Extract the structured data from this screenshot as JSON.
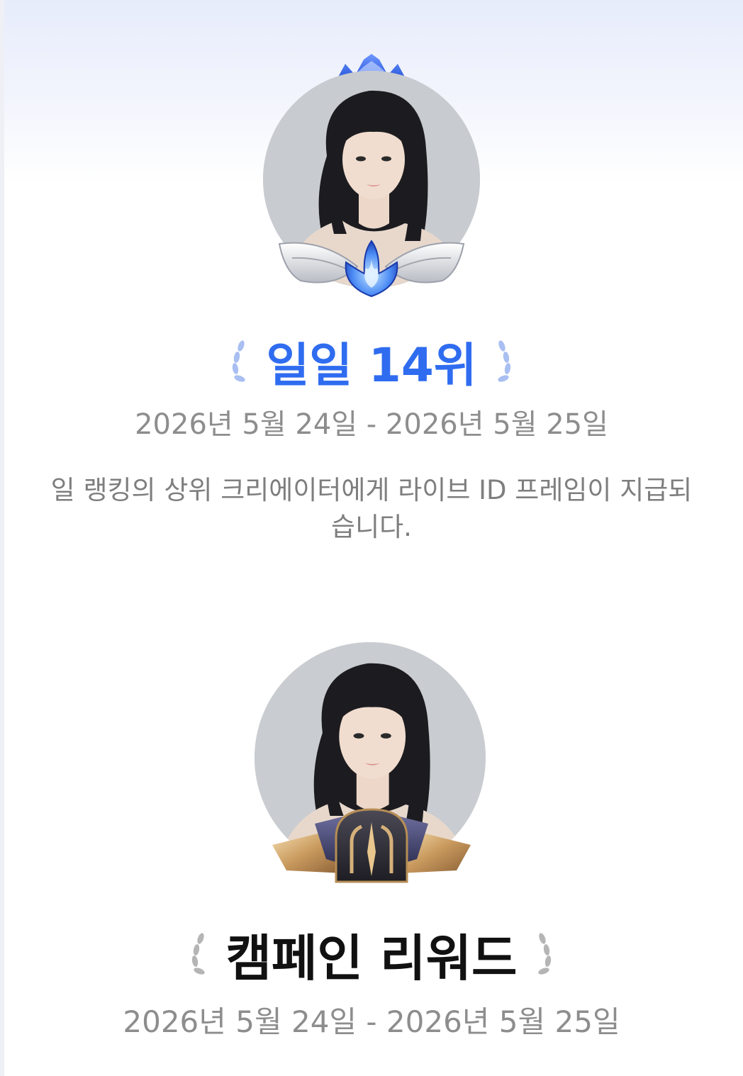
{
  "rewards": [
    {
      "rank_title": "일일 14위",
      "date_range": "2026년 5월 24일 - 2026년 5월 25일",
      "description_line1": "일 랭킹의 상위 크리에이터에게 라이브 ID 프레임이 지급되",
      "description_line2": "습니다.",
      "accent_color": "#2f6cf0",
      "frame_icon": "blue-flame-lotus-icon"
    },
    {
      "rank_title": "캠페인 리워드",
      "date_range": "2026년 5월 24일 - 2026년 5월 25일",
      "accent_color": "#111111",
      "frame_icon": "gold-arch-emblem-icon"
    }
  ],
  "colors": {
    "date_text": "#8d8d8d",
    "description_text": "#7e7e7e",
    "laurel_blue": "#a9bff2",
    "laurel_gray": "#b5b5b5"
  }
}
